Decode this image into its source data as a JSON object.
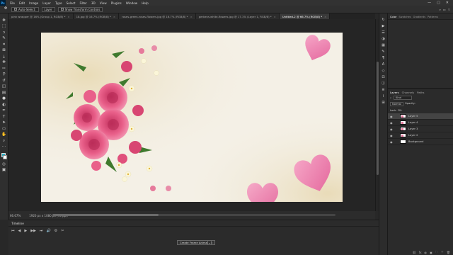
{
  "app": {
    "logo": "Ps"
  },
  "menu": [
    "File",
    "Edit",
    "Image",
    "Layer",
    "Type",
    "Select",
    "Filter",
    "3D",
    "View",
    "Plugins",
    "Window",
    "Help"
  ],
  "window_controls": [
    "—",
    "▢",
    "✕"
  ],
  "options_bar": {
    "auto_select_label": "Auto-Select:",
    "auto_select_value": "Layer",
    "show_transform_label": "Show Transform Controls"
  },
  "tabs": [
    {
      "label": "pink wrapper @ 16% (Group 1, RGB/8) *"
    },
    {
      "label": "18.jpg @ 16.7% (RGB/8) *"
    },
    {
      "label": "roses-green-roses-flowers.jpg @ 16.7% (RGB/8) *"
    },
    {
      "label": "gerbera-white-flowers.jpg @ 17.1% (Layer 1, RGB/8) *"
    },
    {
      "label": "Untitled-2 @ 66.7% (RGB/8) *",
      "active": true
    }
  ],
  "status": {
    "zoom": "66.67%",
    "doc_size": "1920 px x 1080 px (96 ppi)"
  },
  "timeline": {
    "title": "Timeline",
    "controls": [
      "⏮",
      "◀",
      "▶",
      "▶▶",
      "⏭",
      "🔊",
      "⚙",
      "✂"
    ],
    "create_label": "Create Frame Animation",
    "create_arrow": "⌄"
  },
  "right_top_tabs": [
    "Color",
    "Swatches",
    "Gradients",
    "Patterns"
  ],
  "layers_panel": {
    "tabs": [
      "Layers",
      "Channels",
      "Paths"
    ],
    "filter_kind": "Kind",
    "blend_mode": "Normal",
    "opacity_label": "Opacity:",
    "lock_label": "Lock:",
    "fill_label": "Fill:",
    "layers": [
      {
        "name": "Layer 5",
        "selected": true
      },
      {
        "name": "Layer 4"
      },
      {
        "name": "Layer 3"
      },
      {
        "name": "Layer 2"
      },
      {
        "name": "Background"
      }
    ],
    "bottom_icons": [
      "⛓",
      "fx",
      "◐",
      "▣",
      "🗀",
      "＋",
      "🗑"
    ]
  },
  "colors": {
    "foreground": "#2ab0c4",
    "background": "#ffffff",
    "accent_pink": "#f08cb4"
  }
}
